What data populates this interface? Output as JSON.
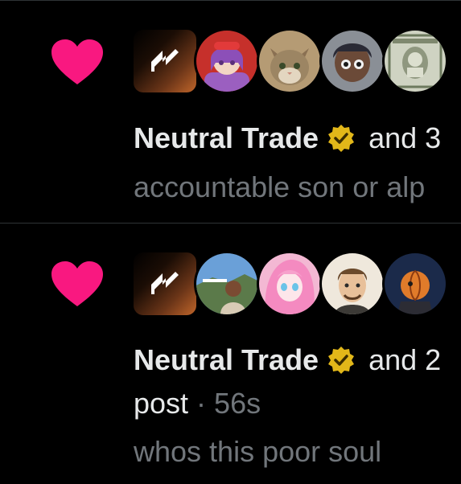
{
  "colors": {
    "background": "#000000",
    "heart": "#f91880",
    "primary_text": "#e7e9ea",
    "secondary_text": "#71767b",
    "divider": "#2f3336",
    "verified_gold": "#e2b719"
  },
  "notifications": [
    {
      "type": "like",
      "icon": "heart-icon",
      "avatars": [
        {
          "icon": "neutral-trade-logo"
        },
        {
          "icon": "anime-girl-avatar"
        },
        {
          "icon": "cat-avatar"
        },
        {
          "icon": "cartoon-face-avatar"
        },
        {
          "icon": "dollar-bill-avatar"
        }
      ],
      "name": "Neutral Trade",
      "verified_icon": "gold-verified-badge-icon",
      "rest": " and 3",
      "snippet": "accountable son or alp"
    },
    {
      "type": "like",
      "icon": "heart-icon",
      "avatars": [
        {
          "icon": "neutral-trade-logo"
        },
        {
          "icon": "person-at-hollywood-avatar"
        },
        {
          "icon": "anime-pink-hair-avatar"
        },
        {
          "icon": "cartoon-man-avatar"
        },
        {
          "icon": "masked-anime-avatar"
        }
      ],
      "name": "Neutral Trade",
      "verified_icon": "gold-verified-badge-icon",
      "rest": " and 2",
      "post_word": "post",
      "separator": " · ",
      "time": "56s",
      "snippet": "whos this poor soul"
    }
  ]
}
